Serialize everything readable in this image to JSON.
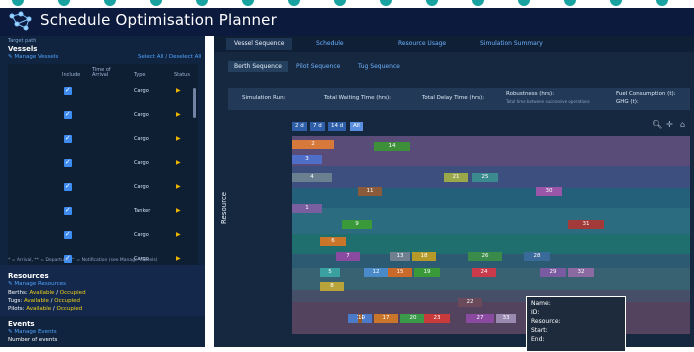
{
  "app": {
    "title": "Schedule Optimisation Planner"
  },
  "sidebar": {
    "target_path": "Target path",
    "vessels_heading": "Vessels",
    "manage_vessels": "Manage Vessels",
    "select_all": "Select All / Deselect All",
    "columns": [
      "Include",
      "Time of Arrival",
      "Type",
      "Status"
    ],
    "rows": [
      {
        "type": "Cargo",
        "status": "▶"
      },
      {
        "type": "Cargo",
        "status": "▶"
      },
      {
        "type": "Cargo",
        "status": "▶"
      },
      {
        "type": "Cargo",
        "status": "▶"
      },
      {
        "type": "Cargo",
        "status": "▶"
      },
      {
        "type": "Tanker",
        "status": "▶"
      },
      {
        "type": "Cargo",
        "status": "▶"
      },
      {
        "type": "Cargo",
        "status": "▶"
      }
    ],
    "legend_line": "* = Arrival, ** = Departure, ^ = Notification (see Manage Vessels)",
    "resources_heading": "Resources",
    "manage_resources": "Manage Resources",
    "berths_label": "Berths:",
    "berths_available": "Available",
    "berths_sep": "/",
    "berths_occupied": "Occupied",
    "tugs_label": "Tugs:",
    "tugs_available": "Available",
    "tugs_sep": "/",
    "tugs_occupied": "Occupied",
    "pilots_label": "Pilots:",
    "pilots_available": "Available",
    "pilots_sep": "/",
    "pilots_occupied": "Occupied",
    "events_heading": "Events",
    "manage_events": "Manage Events",
    "number_of_events": "Number of events"
  },
  "main": {
    "tabs": [
      "Vessel Sequence",
      "Schedule",
      "Resource Usage",
      "Simulation Summary"
    ],
    "subtabs": [
      "Berth Sequence",
      "Pilot Sequence",
      "Tug Sequence"
    ],
    "stats": {
      "sim_run": "Simulation Run:",
      "waiting": "Total Waiting Time (hrs):",
      "delay": "Total Delay Time (hrs):",
      "robustness": "Robustness (hrs):",
      "robustness_note": "Total time between successive operations",
      "fuel": "Fuel Consumption (t):",
      "ghg": "GHG (t):"
    },
    "zoom_buttons": [
      "2 d",
      "7 d",
      "14 d",
      "All"
    ],
    "y_axis_label": "Resource",
    "tooltip": {
      "name": "Name:",
      "id": "ID:",
      "resource": "Resource:",
      "start": "Start:",
      "end": "End:"
    },
    "toolbar_icons": [
      "zoom-in-icon",
      "pan-icon",
      "home-icon"
    ]
  },
  "colors": {
    "bg_header": "#0c1a3e",
    "accent": "#18a3a0",
    "tab_link": "#6fb2ff"
  },
  "chart_data": {
    "type": "gantt",
    "ylabel": "Resource",
    "bars": [
      {
        "label": "2"
      },
      {
        "label": "14"
      },
      {
        "label": "3"
      },
      {
        "label": "4"
      },
      {
        "label": "21"
      },
      {
        "label": "25"
      },
      {
        "label": "11"
      },
      {
        "label": "30"
      },
      {
        "label": "1"
      },
      {
        "label": "9"
      },
      {
        "label": "31"
      },
      {
        "label": "6"
      },
      {
        "label": "7"
      },
      {
        "label": "13"
      },
      {
        "label": "18"
      },
      {
        "label": "26"
      },
      {
        "label": "28"
      },
      {
        "label": "5"
      },
      {
        "label": "12"
      },
      {
        "label": "15"
      },
      {
        "label": "19"
      },
      {
        "label": "24"
      },
      {
        "label": "29"
      },
      {
        "label": "32"
      },
      {
        "label": "8"
      },
      {
        "label": "22"
      },
      {
        "label": "16"
      },
      {
        "label": "10"
      },
      {
        "label": "17"
      },
      {
        "label": "20"
      },
      {
        "label": "23"
      },
      {
        "label": "27"
      },
      {
        "label": "33"
      }
    ]
  }
}
